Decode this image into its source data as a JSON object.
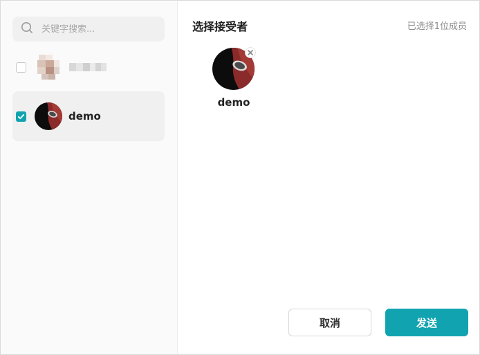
{
  "search": {
    "placeholder": "关键字搜索..."
  },
  "contacts": [
    {
      "name": "",
      "checked": false,
      "blurred": true
    },
    {
      "name": "demo",
      "checked": true,
      "blurred": false
    }
  ],
  "panel": {
    "title": "选择接受者",
    "count_label": "已选择1位成员"
  },
  "selected": [
    {
      "name": "demo"
    }
  ],
  "buttons": {
    "cancel": "取消",
    "send": "发送"
  },
  "colors": {
    "accent": "#12a3b0",
    "pane_bg": "#fafafa",
    "selected_row_bg": "#f0f0f0"
  },
  "icons": {
    "search": "search-icon",
    "check": "checkmark-icon",
    "remove": "close-icon"
  }
}
